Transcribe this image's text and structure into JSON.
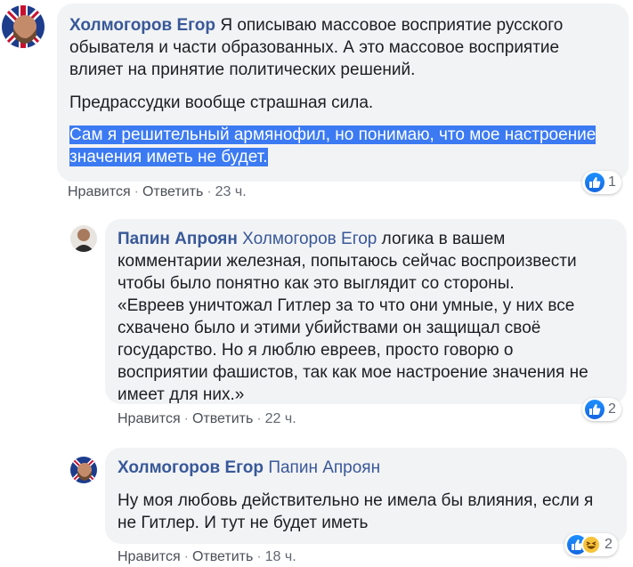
{
  "comments": [
    {
      "author": "Холмогоров Егор",
      "paragraphs": [
        "Я описываю массовое восприятие русского обывателя и части образованных. А это массовое восприятие влияет на принятие политических решений.",
        "Предрассудки вообще страшная сила."
      ],
      "highlighted_line1": "Сам я решительный армянофил, но понимаю, что мое настроение",
      "highlighted_line2": "значения иметь не будет.",
      "like_label": "Нравится",
      "reply_label": "Ответить",
      "time": "23 ч.",
      "reaction_count": "1"
    },
    {
      "author": "Папин Апроян",
      "mention": "Холмогоров Егор",
      "text": "логика в вашем комментарии железная, попытаюсь сейчас воспроизвести чтобы было понятно как это выглядит со стороны.",
      "quote": "«Евреев уничтожал Гитлер за то что они умные, у них все схвачено было и этими убийствами он защищал своё государство. Но я люблю евреев, просто говорю о восприятии фашистов, так как мое настроение значения не имеет для них.»",
      "like_label": "Нравится",
      "reply_label": "Ответить",
      "time": "22 ч.",
      "reaction_count": "2"
    },
    {
      "author": "Холмогоров Егор",
      "mention": "Папин Апроян",
      "text": "Ну моя любовь действительно не имела бы влияния, если я не Гитлер. И тут не будет иметь",
      "like_label": "Нравится",
      "reply_label": "Ответить",
      "time": "18 ч.",
      "reaction_count": "2"
    }
  ]
}
